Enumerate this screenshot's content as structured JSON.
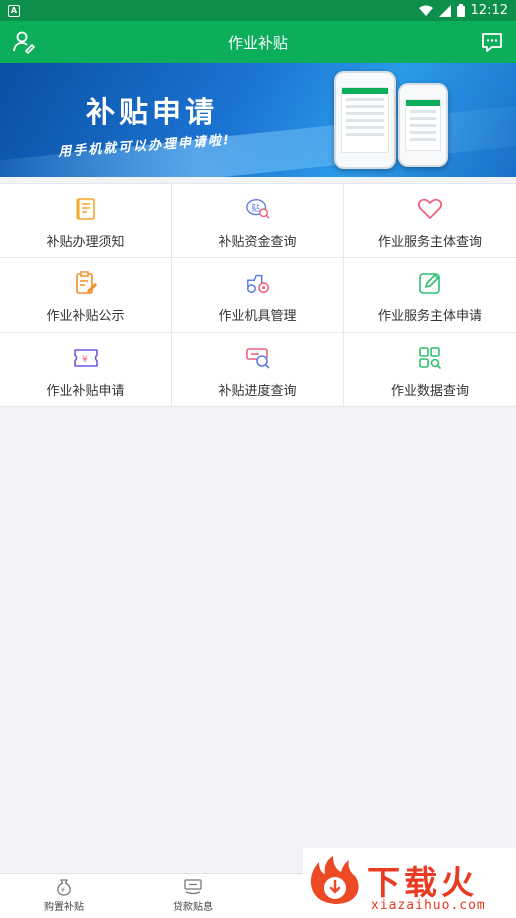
{
  "status_bar": {
    "time": "12:12",
    "app_badge": "A"
  },
  "app_bar": {
    "title": "作业补贴"
  },
  "banner": {
    "title": "补贴申请",
    "subtitle": "用手机就可以办理申请啦!"
  },
  "grid": {
    "items": [
      {
        "label": "补贴办理须知",
        "icon": "notice-doc-icon",
        "color": "#f5a623"
      },
      {
        "label": "补贴资金查询",
        "icon": "fund-search-icon",
        "color": "#5b7fe6"
      },
      {
        "label": "作业服务主体查询",
        "icon": "heart-icon",
        "color": "#f0607a"
      },
      {
        "label": "作业补贴公示",
        "icon": "clipboard-edit-icon",
        "color": "#f28c28"
      },
      {
        "label": "作业机具管理",
        "icon": "tractor-icon",
        "color": "#5b7fe6"
      },
      {
        "label": "作业服务主体申请",
        "icon": "edit-box-icon",
        "color": "#2fbf71"
      },
      {
        "label": "作业补贴申请",
        "icon": "yuan-ticket-icon",
        "color": "#6b5be6"
      },
      {
        "label": "补贴进度查询",
        "icon": "progress-search-icon",
        "color": "#f0607a"
      },
      {
        "label": "作业数据查询",
        "icon": "data-grid-icon",
        "color": "#2fbf71"
      }
    ]
  },
  "bottom_nav": {
    "items": [
      {
        "label": "购置补贴",
        "icon": "money-bag-icon"
      },
      {
        "label": "贷款贴息",
        "icon": "loan-icon"
      }
    ]
  },
  "watermark": {
    "brand": "下载火",
    "url": "xiazaihuo.com"
  },
  "colors": {
    "primary": "#0cae5b",
    "status_bar": "#0b8f4b",
    "page_bg": "#f1f3f6"
  }
}
